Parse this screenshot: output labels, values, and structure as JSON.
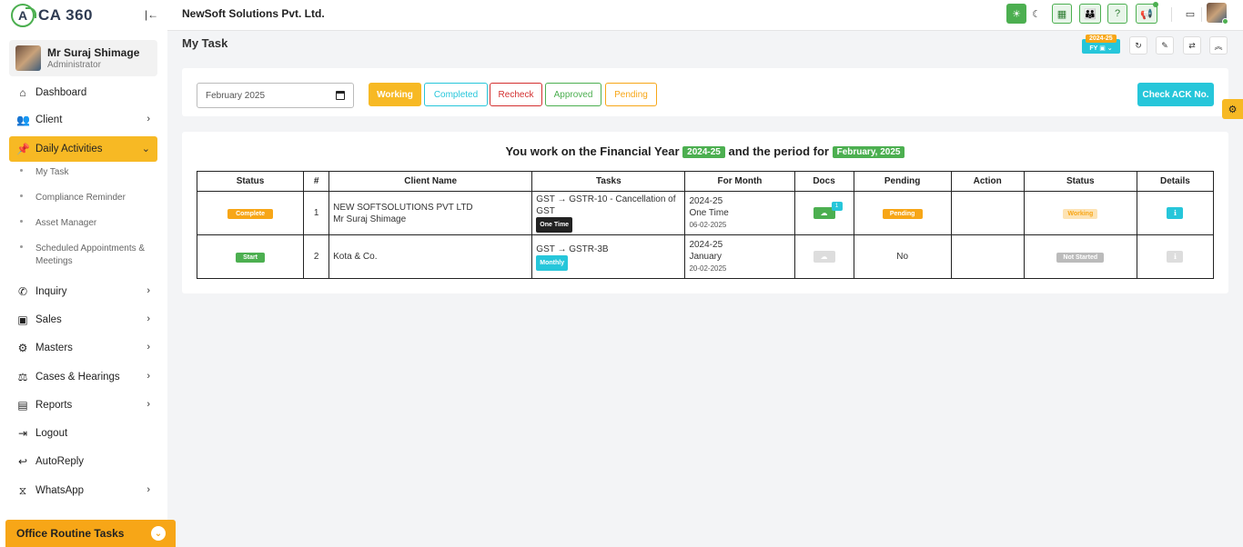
{
  "app": {
    "logo_text": "CA 360",
    "company": "NewSoft Solutions Pvt. Ltd."
  },
  "user": {
    "name": "Mr Suraj Shimage",
    "role": "Administrator"
  },
  "nav": {
    "dashboard": "Dashboard",
    "client": "Client",
    "daily_activities": "Daily Activities",
    "sub": [
      "My Task",
      "Compliance Reminder",
      "Asset Manager",
      "Scheduled Appointments & Meetings"
    ],
    "inquiry": "Inquiry",
    "sales": "Sales",
    "masters": "Masters",
    "cases": "Cases & Hearings",
    "reports": "Reports",
    "logout": "Logout",
    "autoreply": "AutoReply",
    "whatsapp": "WhatsApp",
    "routine": "Office Routine Tasks"
  },
  "page": {
    "title": "My Task",
    "fy_small": "2024-25",
    "fy_label": "FY"
  },
  "filter": {
    "month": "February 2025",
    "working": "Working",
    "completed": "Completed",
    "recheck": "Recheck",
    "approved": "Approved",
    "pending": "Pending",
    "ack": "Check ACK No."
  },
  "heading": {
    "prefix": "You work on the Financial Year",
    "fy": "2024-25",
    "middle": "and the period for",
    "period": "February, 2025"
  },
  "table": {
    "headers": [
      "Status",
      "#",
      "Client Name",
      "Tasks",
      "For Month",
      "Docs",
      "Pending",
      "Action",
      "Status",
      "Details"
    ],
    "rows": [
      {
        "status": "Complete",
        "num": "1",
        "client": "NEW SOFTSOLUTIONS PVT LTD",
        "client_person": "Mr Suraj Shimage",
        "task": "GST → GSTR-10 - Cancellation of GST",
        "task_badge": "One Time",
        "fy": "2024-25",
        "month": "One Time",
        "date": "06-02-2025",
        "docs_count": "1",
        "pending": "Pending",
        "status2": "Working"
      },
      {
        "status": "Start",
        "num": "2",
        "client": "Kota & Co.",
        "client_person": "",
        "task": "GST → GSTR-3B",
        "task_badge": "Monthly",
        "fy": "2024-25",
        "month": "January",
        "date": "20-02-2025",
        "docs_count": "",
        "pending": "No",
        "status2": "Not Started"
      }
    ]
  },
  "colors": {
    "accent": "#f7b924",
    "green": "#4caf50",
    "cyan": "#26c6da",
    "red": "#d32f2f"
  }
}
